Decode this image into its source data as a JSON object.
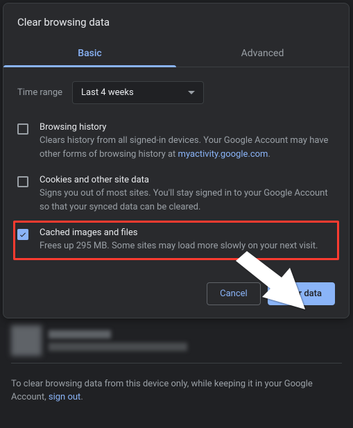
{
  "dialog": {
    "title": "Clear browsing data",
    "tabs": {
      "basic": "Basic",
      "advanced": "Advanced"
    },
    "timerange": {
      "label": "Time range",
      "value": "Last 4 weeks"
    },
    "options": [
      {
        "title": "Browsing history",
        "desc_prefix": "Clears history from all signed-in devices. Your Google Account may have other forms of browsing history at ",
        "link": "myactivity.google.com",
        "desc_suffix": ".",
        "checked": false
      },
      {
        "title": "Cookies and other site data",
        "desc": "Signs you out of most sites. You'll stay signed in to your Google Account so that your synced data can be cleared.",
        "checked": false
      },
      {
        "title": "Cached images and files",
        "desc": "Frees up 295 MB. Some sites may load more slowly on your next visit.",
        "checked": true
      }
    ],
    "buttons": {
      "cancel": "Cancel",
      "clear": "Clear data"
    }
  },
  "footer": {
    "text_prefix": "To clear browsing data from this device only, while keeping it in your Google Account, ",
    "link": "sign out",
    "text_suffix": "."
  }
}
